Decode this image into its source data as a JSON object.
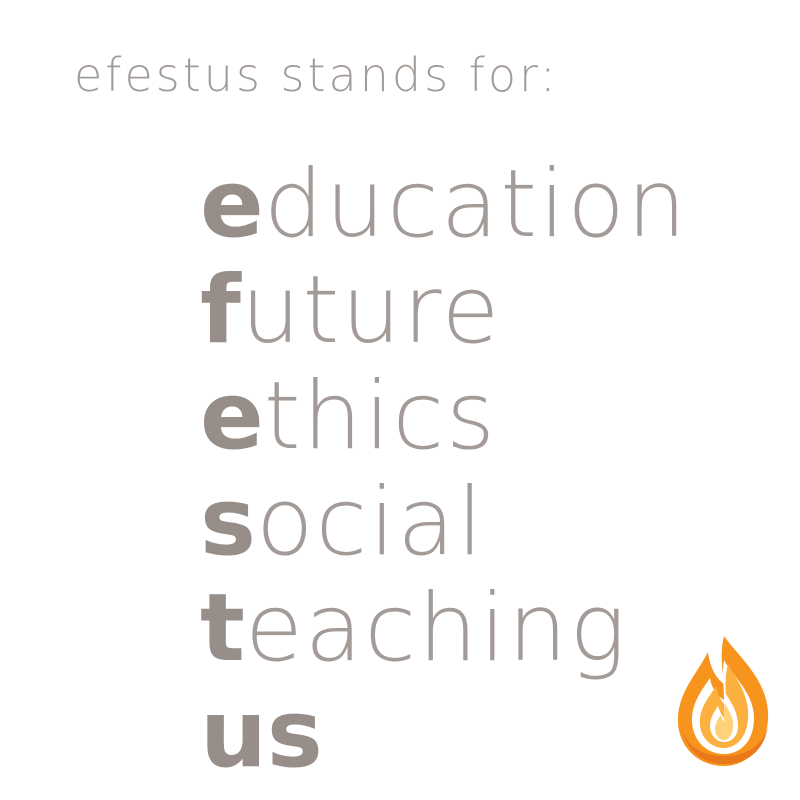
{
  "heading": "efestus stands for:",
  "acrostic": [
    {
      "initial": "e",
      "rest": "ducation"
    },
    {
      "initial": "f",
      "rest": "uture"
    },
    {
      "initial": "e",
      "rest": "thics"
    },
    {
      "initial": "s",
      "rest": "ocial"
    },
    {
      "initial": "t",
      "rest": "eaching"
    },
    {
      "initial": "us",
      "rest": ""
    }
  ],
  "colors": {
    "text": "#a39b97",
    "initial": "#978e89",
    "flame_outer": "#f7941d",
    "flame_inner": "#fbb040",
    "flame_core": "#ffd27a"
  },
  "logo_icon": "flame-icon"
}
